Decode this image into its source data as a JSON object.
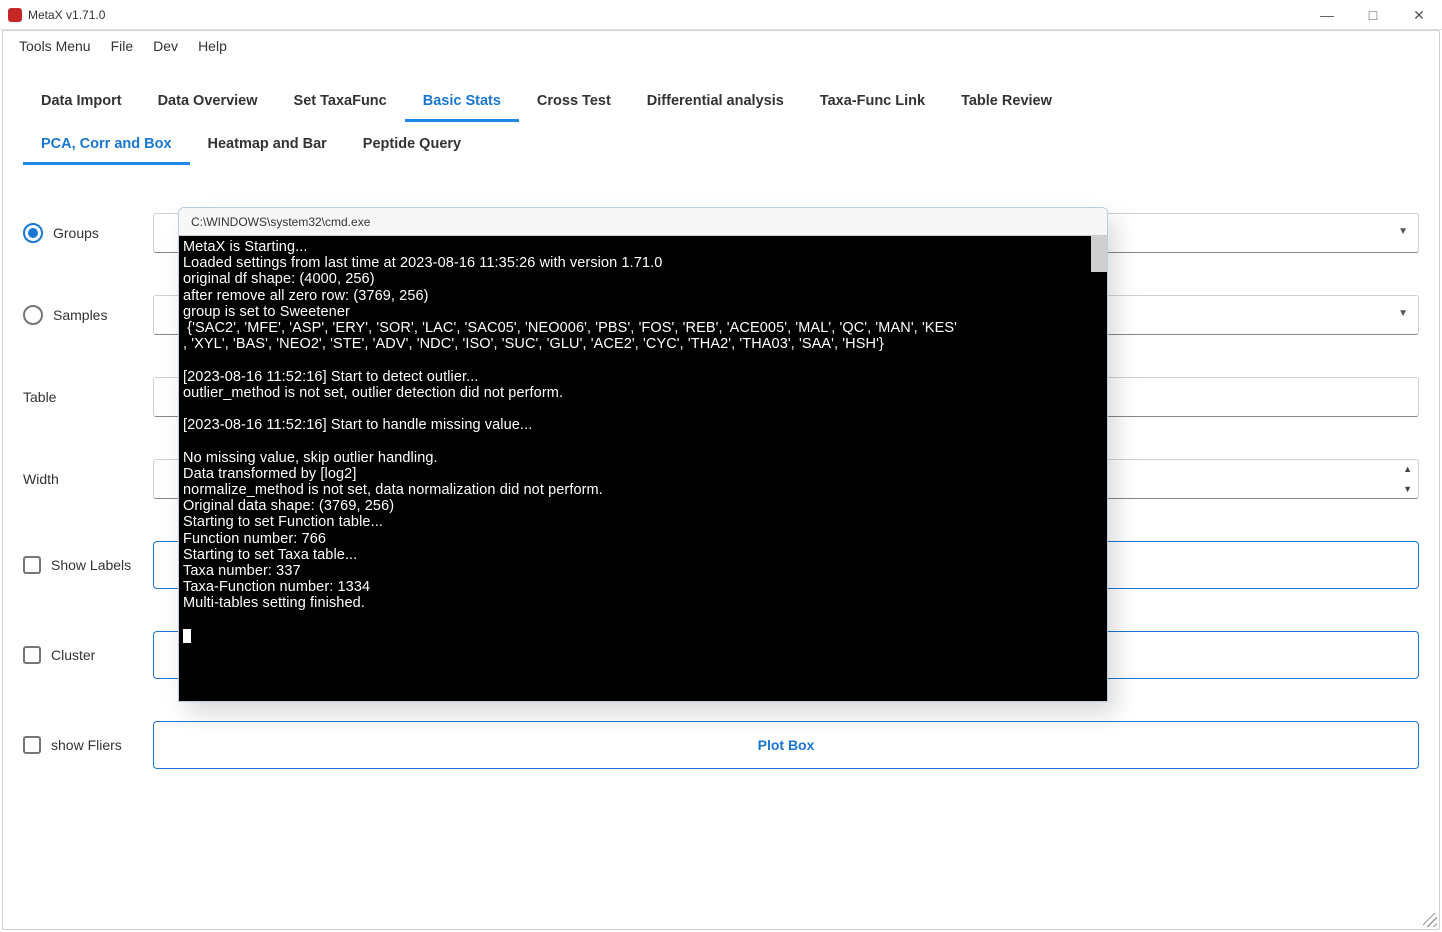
{
  "window": {
    "title": "MetaX v1.71.0",
    "min": "—",
    "max": "□",
    "close": "✕"
  },
  "menubar": [
    "Tools Menu",
    "File",
    "Dev",
    "Help"
  ],
  "main_tabs": [
    "Data Import",
    "Data Overview",
    "Set TaxaFunc",
    "Basic Stats",
    "Cross Test",
    "Differential analysis",
    "Taxa-Func Link",
    "Table Review"
  ],
  "main_tab_active": 3,
  "sub_tabs": [
    "PCA, Corr and Box",
    "Heatmap and Bar",
    "Peptide Query"
  ],
  "sub_tab_active": 0,
  "form": {
    "groups_label": "Groups",
    "samples_label": "Samples",
    "table_label": "Table",
    "width_label": "Width",
    "show_labels_label": "Show Labels",
    "cluster_label": "Cluster",
    "show_fliers_label": "show Fliers",
    "plot_box_button": "Plot Box"
  },
  "console": {
    "title": "C:\\WINDOWS\\system32\\cmd.exe",
    "text": "MetaX is Starting...\nLoaded settings from last time at 2023-08-16 11:35:26 with version 1.71.0\noriginal df shape: (4000, 256)\nafter remove all zero row: (3769, 256)\ngroup is set to Sweetener\n {'SAC2', 'MFE', 'ASP', 'ERY', 'SOR', 'LAC', 'SAC05', 'NEO006', 'PBS', 'FOS', 'REB', 'ACE005', 'MAL', 'QC', 'MAN', 'KES'\n, 'XYL', 'BAS', 'NEO2', 'STE', 'ADV', 'NDC', 'ISO', 'SUC', 'GLU', 'ACE2', 'CYC', 'THA2', 'THA03', 'SAA', 'HSH'}\n\n[2023-08-16 11:52:16] Start to detect outlier...\noutlier_method is not set, outlier detection did not perform.\n\n[2023-08-16 11:52:16] Start to handle missing value...\n\nNo missing value, skip outlier handling.\nData transformed by [log2]\nnormalize_method is not set, data normalization did not perform.\nOriginal data shape: (3769, 256)\nStarting to set Function table...\nFunction number: 766\nStarting to set Taxa table...\nTaxa number: 337\nTaxa-Function number: 1334\nMulti-tables setting finished.\n"
  }
}
